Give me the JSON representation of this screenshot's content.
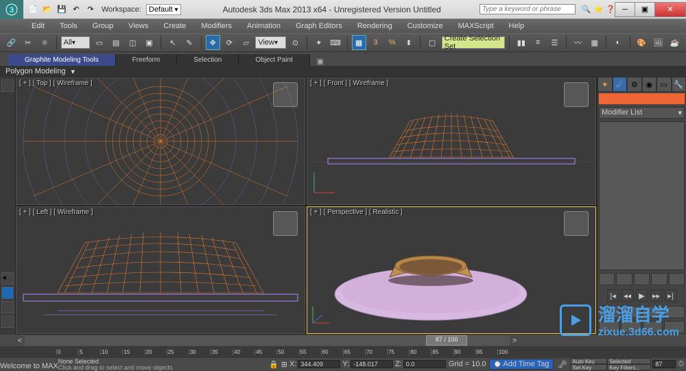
{
  "title": "Autodesk 3ds Max 2013 x64  - Unregistered Version   Untitled",
  "workspace_label": "Workspace:",
  "workspace_value": "Default",
  "search_placeholder": "Type a keyword or phrase",
  "menu": [
    "Edit",
    "Tools",
    "Group",
    "Views",
    "Create",
    "Modifiers",
    "Animation",
    "Graph Editors",
    "Rendering",
    "Customize",
    "MAXScript",
    "Help"
  ],
  "toolbar": {
    "selfilter": "All",
    "view": "View",
    "angle": "3",
    "percent": "%",
    "selset": "Create Selection Set"
  },
  "ribbon": {
    "tabs": [
      "Graphite Modeling Tools",
      "Freeform",
      "Selection",
      "Object Paint"
    ],
    "subtitle": "Polygon Modeling"
  },
  "viewports": {
    "tl": "[ + ] [ Top ] [ Wireframe ]",
    "tr": "[ + ] [ Front ] [ Wireframe ]",
    "bl": "[ + ] [ Left ] [ Wireframe ]",
    "br": "[ + ] [ Perspective ] [ Realistic ]"
  },
  "cmdpanel": {
    "mod_label": "Modifier List"
  },
  "slider": {
    "pos": "87 / 100"
  },
  "ticks": [
    "0",
    "5",
    "10",
    "15",
    "20",
    "25",
    "30",
    "35",
    "40",
    "45",
    "50",
    "55",
    "60",
    "65",
    "70",
    "75",
    "80",
    "85",
    "90",
    "95",
    "100"
  ],
  "status": {
    "prompt": "Welcome to MAX",
    "sel": "None Selected",
    "hint": "Click and drag to select and move objects",
    "x": "344.409",
    "y": "-148.017",
    "z": "0.0",
    "grid": "Grid = 10.0",
    "addtag": "Add Time Tag",
    "autokey": "Auto Key",
    "setkey": "Set Key",
    "keyfilters": "Key Filters...",
    "frame": "87",
    "selected_filter": "Selected"
  },
  "watermark": {
    "cn": "溜溜自学",
    "url": "zixue.3d66.com"
  }
}
